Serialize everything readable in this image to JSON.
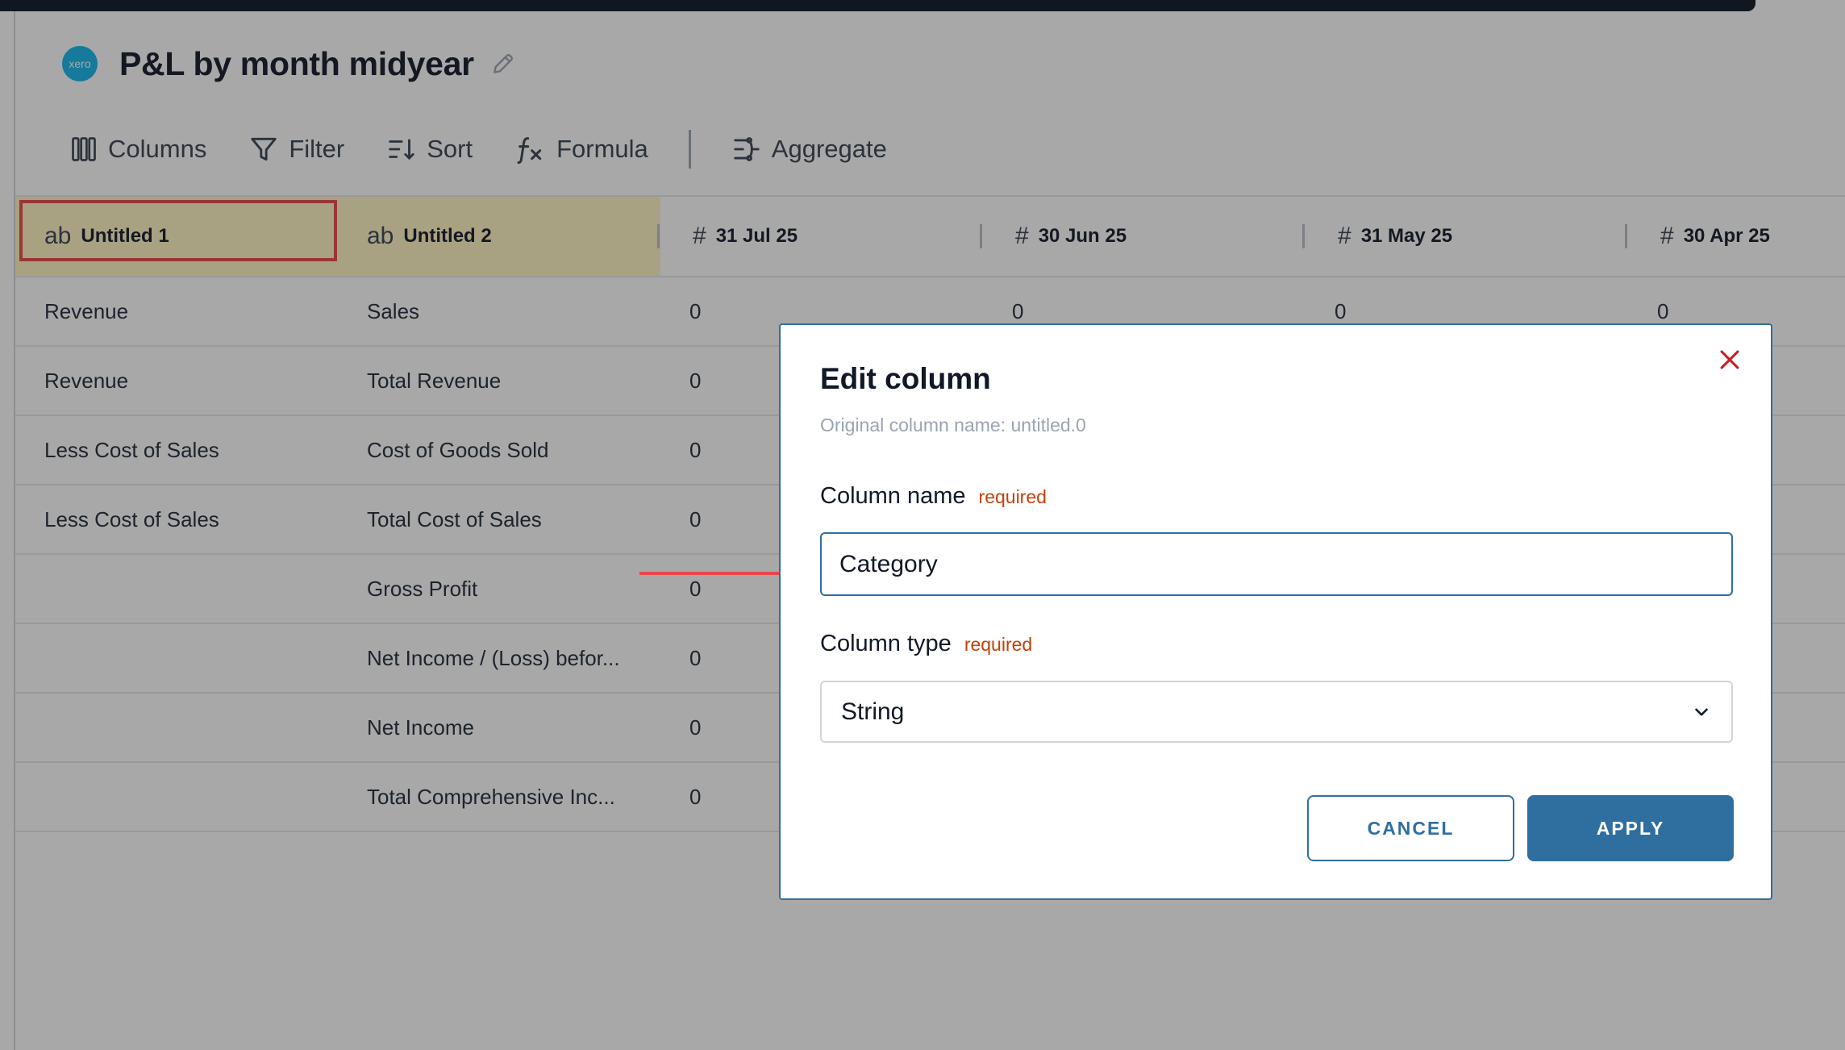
{
  "page": {
    "logo_text": "xero",
    "title": "P&L by month midyear"
  },
  "toolbar": {
    "columns": "Columns",
    "filter": "Filter",
    "sort": "Sort",
    "formula": "Formula",
    "aggregate": "Aggregate"
  },
  "table": {
    "headers": [
      {
        "type": "ab",
        "label": "Untitled 1"
      },
      {
        "type": "ab",
        "label": "Untitled 2"
      },
      {
        "type": "#",
        "label": "31 Jul 25"
      },
      {
        "type": "#",
        "label": "30 Jun 25"
      },
      {
        "type": "#",
        "label": "31 May 25"
      },
      {
        "type": "#",
        "label": "30 Apr 25"
      }
    ],
    "rows": [
      [
        "Revenue",
        "Sales",
        "0",
        "0",
        "0",
        "0"
      ],
      [
        "Revenue",
        "Total Revenue",
        "0",
        "",
        "",
        ""
      ],
      [
        "Less Cost of Sales",
        "Cost of Goods Sold",
        "0",
        "",
        "",
        ""
      ],
      [
        "Less Cost of Sales",
        "Total Cost of Sales",
        "0",
        "",
        "",
        ""
      ],
      [
        "",
        "Gross Profit",
        "0",
        "",
        "",
        ""
      ],
      [
        "",
        "Net Income / (Loss) befor...",
        "0",
        "",
        "",
        ""
      ],
      [
        "",
        "Net Income",
        "0",
        "",
        "",
        ""
      ],
      [
        "",
        "Total Comprehensive Inc...",
        "0",
        "",
        "",
        ""
      ]
    ]
  },
  "modal": {
    "title": "Edit column",
    "subtitle": "Original column name: untitled.0",
    "name_label": "Column name",
    "name_required": "required",
    "name_value": "Category",
    "type_label": "Column type",
    "type_required": "required",
    "type_value": "String",
    "cancel": "CANCEL",
    "apply": "APPLY"
  },
  "colors": {
    "accent": "#2f6f9f",
    "highlight": "#e5484d",
    "string_column_bg": "#fff6c4",
    "required_text": "#c2410c"
  }
}
